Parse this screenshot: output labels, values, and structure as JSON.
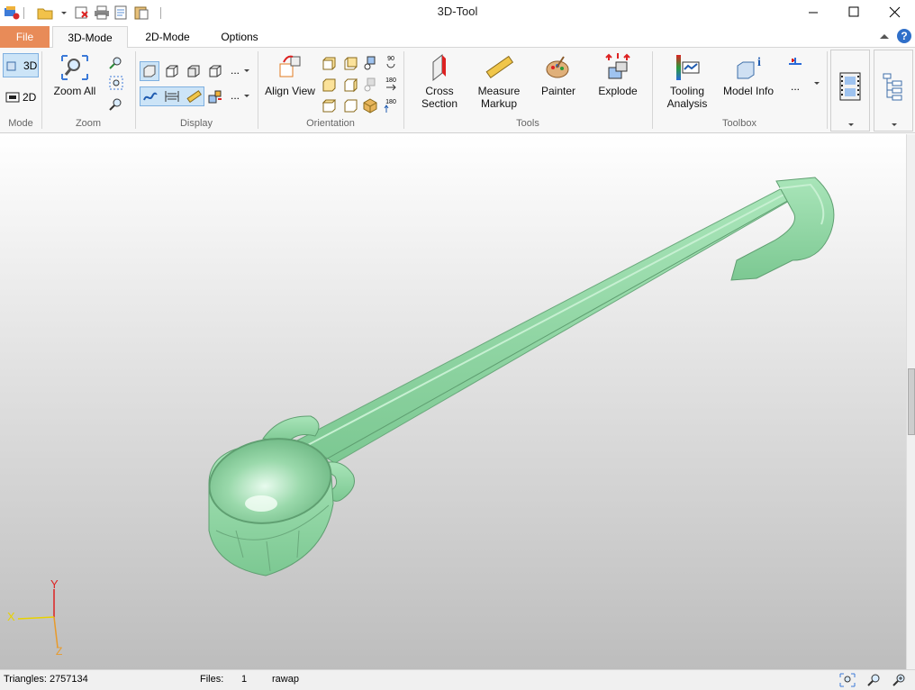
{
  "window": {
    "title": "3D-Tool"
  },
  "tabs": [
    {
      "label": "File"
    },
    {
      "label": "3D-Mode"
    },
    {
      "label": "2D-Mode"
    },
    {
      "label": "Options"
    }
  ],
  "ribbon": {
    "mode": {
      "label": "Mode",
      "btn_3d": "3D",
      "btn_2d": "2D"
    },
    "zoom": {
      "label": "Zoom",
      "zoom_all": "Zoom All"
    },
    "display": {
      "label": "Display",
      "more1": "...",
      "more2": "..."
    },
    "orientation": {
      "label": "Orientation",
      "align_view": "Align View",
      "rot90": "90",
      "rot180a": "180",
      "rot180b": "180"
    },
    "tools": {
      "label": "Tools",
      "cross_section_1": "Cross",
      "cross_section_2": "Section",
      "measure_1": "Measure",
      "measure_2": "Markup",
      "painter": "Painter",
      "explode": "Explode"
    },
    "toolbox": {
      "label": "Toolbox",
      "tooling_1": "Tooling",
      "tooling_2": "Analysis",
      "model_info": "Model Info",
      "more": "..."
    }
  },
  "axes": {
    "x": "X",
    "y": "Y",
    "z": "Z"
  },
  "status": {
    "triangles": "Triangles: 2757134",
    "files_label": "Files:",
    "files_count": "1",
    "filename": "rawap"
  },
  "colors": {
    "file_tab": "#e88b58",
    "model": "#8fd9a6",
    "selected": "#cce4f7"
  }
}
